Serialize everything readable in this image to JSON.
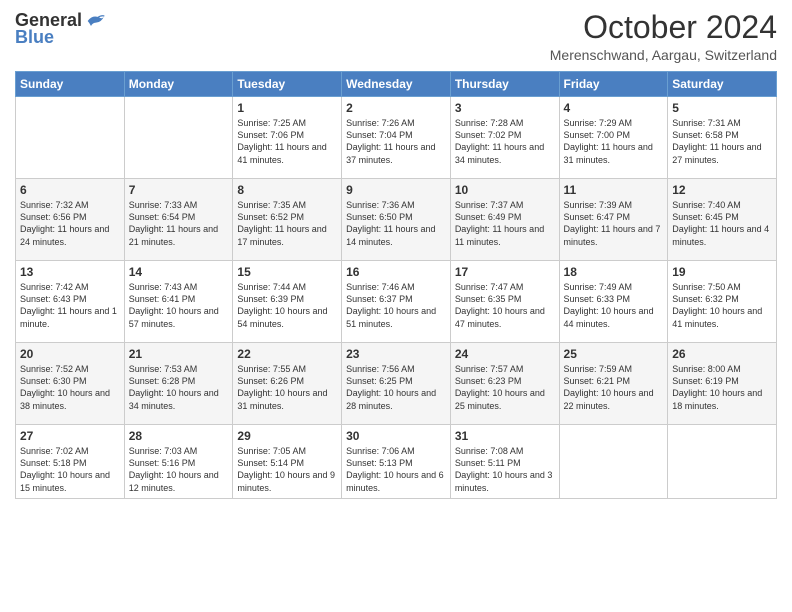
{
  "logo": {
    "general": "General",
    "blue": "Blue"
  },
  "title": "October 2024",
  "location": "Merenschwand, Aargau, Switzerland",
  "days_of_week": [
    "Sunday",
    "Monday",
    "Tuesday",
    "Wednesday",
    "Thursday",
    "Friday",
    "Saturday"
  ],
  "weeks": [
    [
      {
        "day": "",
        "info": ""
      },
      {
        "day": "",
        "info": ""
      },
      {
        "day": "1",
        "info": "Sunrise: 7:25 AM\nSunset: 7:06 PM\nDaylight: 11 hours and 41 minutes."
      },
      {
        "day": "2",
        "info": "Sunrise: 7:26 AM\nSunset: 7:04 PM\nDaylight: 11 hours and 37 minutes."
      },
      {
        "day": "3",
        "info": "Sunrise: 7:28 AM\nSunset: 7:02 PM\nDaylight: 11 hours and 34 minutes."
      },
      {
        "day": "4",
        "info": "Sunrise: 7:29 AM\nSunset: 7:00 PM\nDaylight: 11 hours and 31 minutes."
      },
      {
        "day": "5",
        "info": "Sunrise: 7:31 AM\nSunset: 6:58 PM\nDaylight: 11 hours and 27 minutes."
      }
    ],
    [
      {
        "day": "6",
        "info": "Sunrise: 7:32 AM\nSunset: 6:56 PM\nDaylight: 11 hours and 24 minutes."
      },
      {
        "day": "7",
        "info": "Sunrise: 7:33 AM\nSunset: 6:54 PM\nDaylight: 11 hours and 21 minutes."
      },
      {
        "day": "8",
        "info": "Sunrise: 7:35 AM\nSunset: 6:52 PM\nDaylight: 11 hours and 17 minutes."
      },
      {
        "day": "9",
        "info": "Sunrise: 7:36 AM\nSunset: 6:50 PM\nDaylight: 11 hours and 14 minutes."
      },
      {
        "day": "10",
        "info": "Sunrise: 7:37 AM\nSunset: 6:49 PM\nDaylight: 11 hours and 11 minutes."
      },
      {
        "day": "11",
        "info": "Sunrise: 7:39 AM\nSunset: 6:47 PM\nDaylight: 11 hours and 7 minutes."
      },
      {
        "day": "12",
        "info": "Sunrise: 7:40 AM\nSunset: 6:45 PM\nDaylight: 11 hours and 4 minutes."
      }
    ],
    [
      {
        "day": "13",
        "info": "Sunrise: 7:42 AM\nSunset: 6:43 PM\nDaylight: 11 hours and 1 minute."
      },
      {
        "day": "14",
        "info": "Sunrise: 7:43 AM\nSunset: 6:41 PM\nDaylight: 10 hours and 57 minutes."
      },
      {
        "day": "15",
        "info": "Sunrise: 7:44 AM\nSunset: 6:39 PM\nDaylight: 10 hours and 54 minutes."
      },
      {
        "day": "16",
        "info": "Sunrise: 7:46 AM\nSunset: 6:37 PM\nDaylight: 10 hours and 51 minutes."
      },
      {
        "day": "17",
        "info": "Sunrise: 7:47 AM\nSunset: 6:35 PM\nDaylight: 10 hours and 47 minutes."
      },
      {
        "day": "18",
        "info": "Sunrise: 7:49 AM\nSunset: 6:33 PM\nDaylight: 10 hours and 44 minutes."
      },
      {
        "day": "19",
        "info": "Sunrise: 7:50 AM\nSunset: 6:32 PM\nDaylight: 10 hours and 41 minutes."
      }
    ],
    [
      {
        "day": "20",
        "info": "Sunrise: 7:52 AM\nSunset: 6:30 PM\nDaylight: 10 hours and 38 minutes."
      },
      {
        "day": "21",
        "info": "Sunrise: 7:53 AM\nSunset: 6:28 PM\nDaylight: 10 hours and 34 minutes."
      },
      {
        "day": "22",
        "info": "Sunrise: 7:55 AM\nSunset: 6:26 PM\nDaylight: 10 hours and 31 minutes."
      },
      {
        "day": "23",
        "info": "Sunrise: 7:56 AM\nSunset: 6:25 PM\nDaylight: 10 hours and 28 minutes."
      },
      {
        "day": "24",
        "info": "Sunrise: 7:57 AM\nSunset: 6:23 PM\nDaylight: 10 hours and 25 minutes."
      },
      {
        "day": "25",
        "info": "Sunrise: 7:59 AM\nSunset: 6:21 PM\nDaylight: 10 hours and 22 minutes."
      },
      {
        "day": "26",
        "info": "Sunrise: 8:00 AM\nSunset: 6:19 PM\nDaylight: 10 hours and 18 minutes."
      }
    ],
    [
      {
        "day": "27",
        "info": "Sunrise: 7:02 AM\nSunset: 5:18 PM\nDaylight: 10 hours and 15 minutes."
      },
      {
        "day": "28",
        "info": "Sunrise: 7:03 AM\nSunset: 5:16 PM\nDaylight: 10 hours and 12 minutes."
      },
      {
        "day": "29",
        "info": "Sunrise: 7:05 AM\nSunset: 5:14 PM\nDaylight: 10 hours and 9 minutes."
      },
      {
        "day": "30",
        "info": "Sunrise: 7:06 AM\nSunset: 5:13 PM\nDaylight: 10 hours and 6 minutes."
      },
      {
        "day": "31",
        "info": "Sunrise: 7:08 AM\nSunset: 5:11 PM\nDaylight: 10 hours and 3 minutes."
      },
      {
        "day": "",
        "info": ""
      },
      {
        "day": "",
        "info": ""
      }
    ]
  ]
}
